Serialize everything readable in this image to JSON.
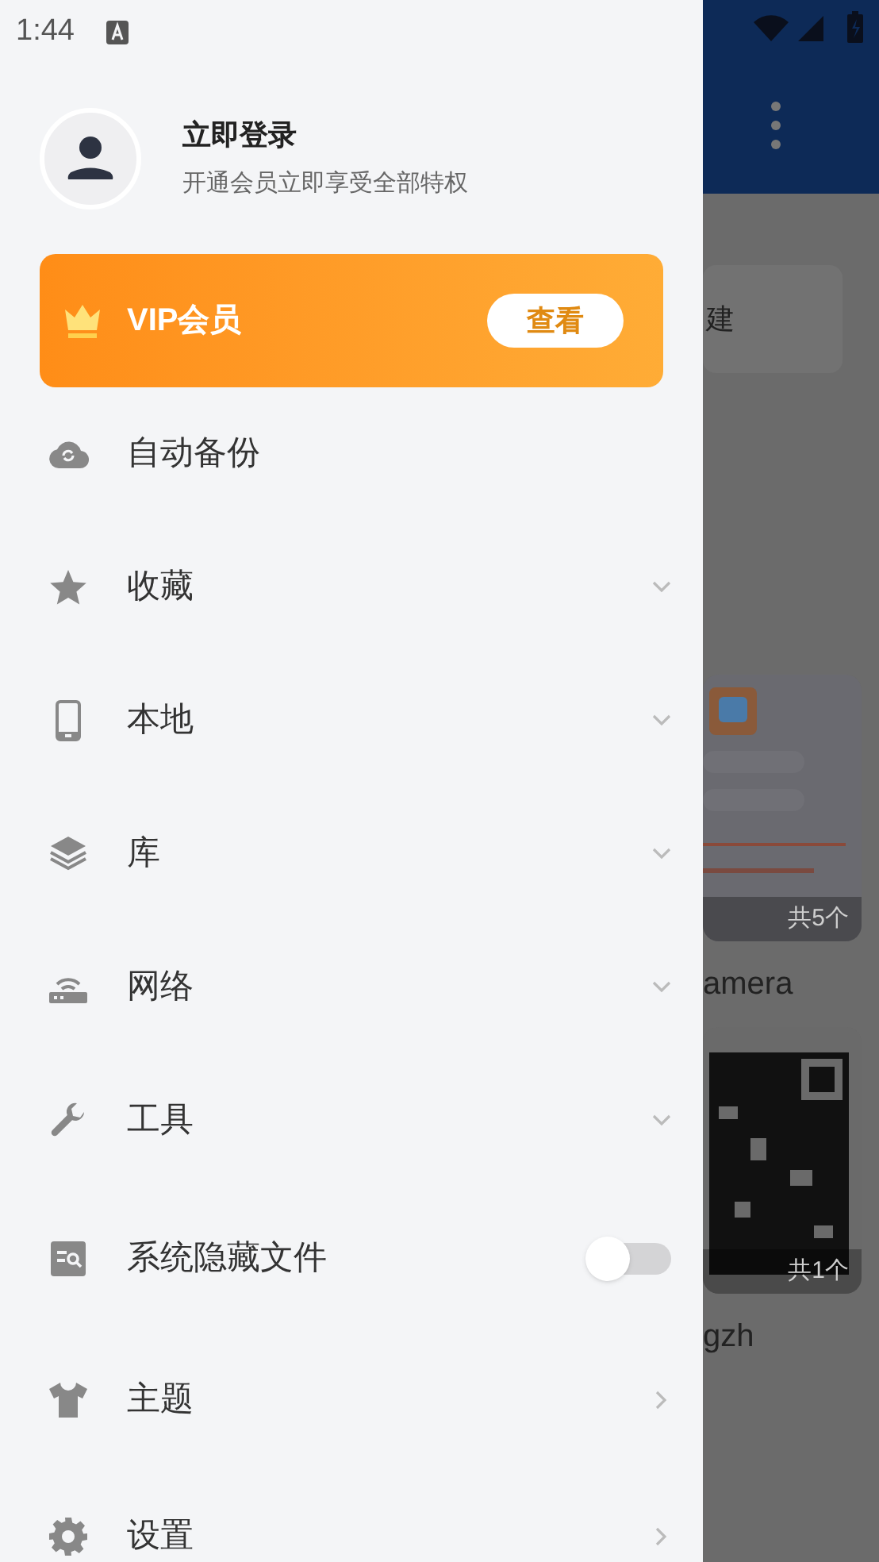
{
  "status_bar": {
    "time": "1:44"
  },
  "profile": {
    "title": "立即登录",
    "subtitle": "开通会员立即享受全部特权"
  },
  "vip_banner": {
    "label": "VIP会员",
    "button": "查看"
  },
  "menu": [
    {
      "label": "自动备份",
      "kind": "plain"
    },
    {
      "label": "收藏",
      "kind": "expand",
      "expanded": false
    },
    {
      "label": "本地",
      "kind": "expand",
      "expanded": false
    },
    {
      "label": "库",
      "kind": "expand",
      "expanded": false
    },
    {
      "label": "网络",
      "kind": "expand",
      "expanded": false
    },
    {
      "label": "工具",
      "kind": "expand",
      "expanded": false
    },
    {
      "label": "系统隐藏文件",
      "kind": "toggle",
      "on": false
    },
    {
      "label": "主题",
      "kind": "link"
    },
    {
      "label": "设置",
      "kind": "link"
    }
  ],
  "background": {
    "card_text": "建",
    "albums": [
      {
        "count": "共5个",
        "name": "amera"
      },
      {
        "count": "共1个",
        "name": "gzh"
      }
    ]
  }
}
